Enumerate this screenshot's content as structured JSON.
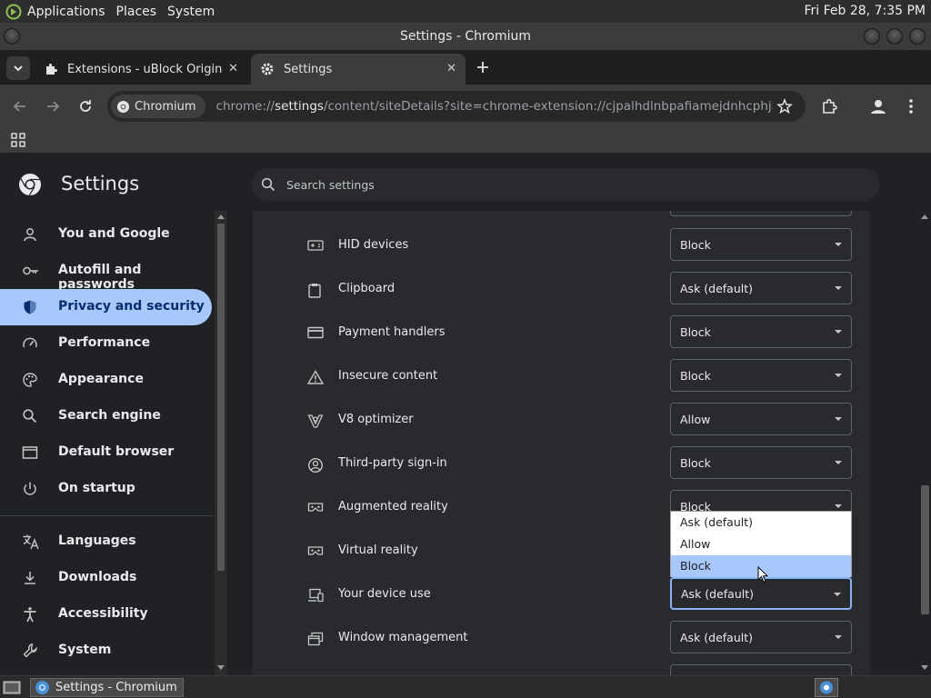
{
  "top_panel": {
    "menus": [
      "Applications",
      "Places",
      "System"
    ],
    "clock": "Fri Feb 28,  7:35 PM"
  },
  "window": {
    "title": "Settings - Chromium"
  },
  "tabs": [
    {
      "label": "Extensions - uBlock Origin",
      "icon": "puzzle-icon",
      "active": false
    },
    {
      "label": "Settings",
      "icon": "gear-icon",
      "active": true
    }
  ],
  "toolbar": {
    "site_chip": "Chromium",
    "url_prefix": "chrome://",
    "url_host": "settings",
    "url_path": "/content/siteDetails?site=chrome-extension://cjpalhdlnbpafiamejdnhcphjbkeiagm"
  },
  "settings": {
    "title": "Settings",
    "search_placeholder": "Search settings"
  },
  "sidebar": {
    "items": [
      {
        "label": "You and Google",
        "icon": "person-icon"
      },
      {
        "label": "Autofill and passwords",
        "icon": "key-icon"
      },
      {
        "label": "Privacy and security",
        "icon": "shield-icon",
        "active": true
      },
      {
        "label": "Performance",
        "icon": "gauge-icon"
      },
      {
        "label": "Appearance",
        "icon": "palette-icon"
      },
      {
        "label": "Search engine",
        "icon": "search-icon"
      },
      {
        "label": "Default browser",
        "icon": "browser-window-icon"
      },
      {
        "label": "On startup",
        "icon": "power-icon"
      },
      {
        "label": "Languages",
        "icon": "translate-icon"
      },
      {
        "label": "Downloads",
        "icon": "download-icon"
      },
      {
        "label": "Accessibility",
        "icon": "accessibility-icon"
      },
      {
        "label": "System",
        "icon": "wrench-icon"
      }
    ]
  },
  "permissions": [
    {
      "label": "HID devices",
      "value": "Block",
      "icon": "hid-device-icon"
    },
    {
      "label": "Clipboard",
      "value": "Ask (default)",
      "icon": "clipboard-icon"
    },
    {
      "label": "Payment handlers",
      "value": "Block",
      "icon": "card-icon"
    },
    {
      "label": "Insecure content",
      "value": "Block",
      "icon": "warning-icon"
    },
    {
      "label": "V8 optimizer",
      "value": "Allow",
      "icon": "v8-icon"
    },
    {
      "label": "Third-party sign-in",
      "value": "Block",
      "icon": "account-circle-icon"
    },
    {
      "label": "Augmented reality",
      "value": "Block",
      "icon": "vr-headset-icon"
    },
    {
      "label": "Virtual reality",
      "value": "",
      "icon": "vr-headset-icon"
    },
    {
      "label": "Your device use",
      "value": "Ask (default)",
      "icon": "devices-icon",
      "focused": true
    },
    {
      "label": "Window management",
      "value": "Ask (default)",
      "icon": "window-management-icon"
    }
  ],
  "dropdown": {
    "options": [
      "Ask (default)",
      "Allow",
      "Block"
    ],
    "highlighted": "Block"
  },
  "taskbar": {
    "task_label": "Settings - Chromium"
  }
}
